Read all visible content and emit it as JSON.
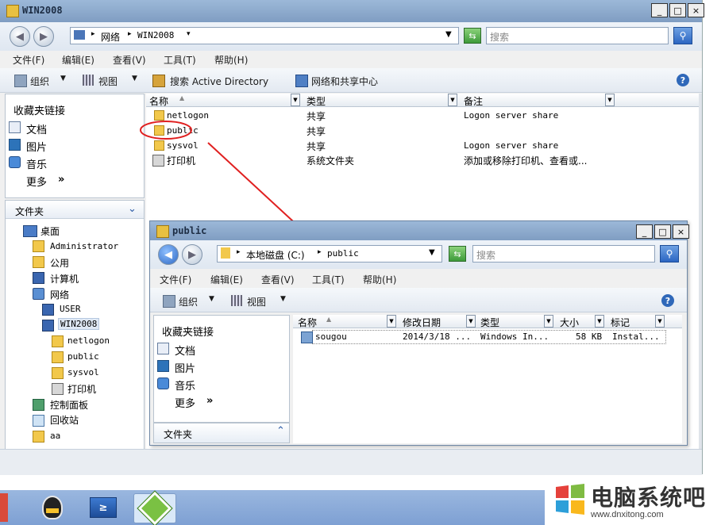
{
  "main_window": {
    "title": "WIN2008",
    "window_controls": [
      "_",
      "□",
      "×"
    ],
    "nav": {
      "back_icon": "back-arrow-icon",
      "forward_icon": "forward-arrow-icon",
      "breadcrumb": [
        "网络",
        "WIN2008"
      ],
      "search_placeholder": "搜索"
    },
    "menu": [
      "文件(F)",
      "编辑(E)",
      "查看(V)",
      "工具(T)",
      "帮助(H)"
    ],
    "toolbar": {
      "organize": "组织",
      "views": "视图",
      "search_ad": "搜索 Active Directory",
      "network_center": "网络和共享中心"
    },
    "sidebar": {
      "favorites_title": "收藏夹链接",
      "favorites": [
        "文档",
        "图片",
        "音乐"
      ],
      "more": "更多",
      "folders_title": "文件夹",
      "tree": [
        {
          "label": "桌面",
          "icon": "desktop-icon"
        },
        {
          "label": "Administrator",
          "icon": "user-folder-icon"
        },
        {
          "label": "公用",
          "icon": "folder-icon"
        },
        {
          "label": "计算机",
          "icon": "computer-icon"
        },
        {
          "label": "网络",
          "icon": "network-icon"
        },
        {
          "label": "USER",
          "icon": "computer-icon"
        },
        {
          "label": "WIN2008",
          "icon": "computer-icon"
        },
        {
          "label": "netlogon",
          "icon": "share-folder-icon"
        },
        {
          "label": "public",
          "icon": "share-folder-icon"
        },
        {
          "label": "sysvol",
          "icon": "share-folder-icon"
        },
        {
          "label": "打印机",
          "icon": "printer-icon"
        },
        {
          "label": "控制面板",
          "icon": "control-panel-icon"
        },
        {
          "label": "回收站",
          "icon": "recycle-bin-icon"
        },
        {
          "label": "aa",
          "icon": "folder-icon"
        }
      ]
    },
    "columns": [
      "名称",
      "类型",
      "备注"
    ],
    "rows": [
      {
        "name": "netlogon",
        "type": "共享",
        "note": "Logon server share"
      },
      {
        "name": "public",
        "type": "共享",
        "note": ""
      },
      {
        "name": "sysvol",
        "type": "共享",
        "note": "Logon server share"
      },
      {
        "name": "打印机",
        "type": "系统文件夹",
        "note": "添加或移除打印机、查看或..."
      }
    ]
  },
  "inner_window": {
    "title": "public",
    "breadcrumb": [
      "本地磁盘 (C:)",
      "public"
    ],
    "search_placeholder": "搜索",
    "menu": [
      "文件(F)",
      "编辑(E)",
      "查看(V)",
      "工具(T)",
      "帮助(H)"
    ],
    "toolbar": {
      "organize": "组织",
      "views": "视图"
    },
    "sidebar": {
      "favorites_title": "收藏夹链接",
      "favorites": [
        "文档",
        "图片",
        "音乐"
      ],
      "more": "更多",
      "folders_title": "文件夹"
    },
    "columns": [
      "名称",
      "修改日期",
      "类型",
      "大小",
      "标记"
    ],
    "rows": [
      {
        "name": "sougou",
        "date": "2014/3/18 ...",
        "type": "Windows In...",
        "size": "58 KB",
        "tag": "Instal..."
      }
    ]
  },
  "taskbar": {
    "apps": [
      "qq-icon",
      "powershell-icon",
      "server-manager-icon"
    ]
  },
  "watermark": {
    "title": "电脑系统吧",
    "url": "www.dnxitong.com"
  },
  "colors": {
    "highlight_circle": "#e02020",
    "arrow": "#e02020",
    "titlebar": "#8faccf",
    "taskbar": "#8aa9d8"
  }
}
